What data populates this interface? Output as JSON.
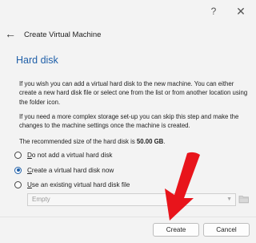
{
  "titlebar": {
    "help_label": "?",
    "close_label": "✕"
  },
  "header": {
    "back_label": "←",
    "title": "Create Virtual Machine"
  },
  "section_title": "Hard disk",
  "paragraphs": {
    "p1": "If you wish you can add a virtual hard disk to the new machine. You can either create a new hard disk file or select one from the list or from another location using the folder icon.",
    "p2": "If you need a more complex storage set-up you can skip this step and make the changes to the machine settings once the machine is created.",
    "p3_prefix": "The recommended size of the hard disk is ",
    "p3_size": "50.00 GB",
    "p3_suffix": "."
  },
  "options": {
    "no_disk": {
      "mnemonic": "D",
      "rest": "o not add a virtual hard disk",
      "selected": false
    },
    "create_now": {
      "mnemonic": "C",
      "rest": "reate a virtual hard disk now",
      "selected": true
    },
    "use_existing": {
      "mnemonic": "U",
      "rest": "se an existing virtual hard disk file",
      "selected": false
    }
  },
  "existing_disk_combo": {
    "value": "Empty",
    "arrow": "▼"
  },
  "buttons": {
    "create": "Create",
    "cancel": "Cancel"
  },
  "colors": {
    "accent": "#1f5fa8",
    "annotation_arrow": "#e8141b"
  },
  "icons": [
    "help-icon",
    "close-icon",
    "back-arrow-icon",
    "folder-icon",
    "chevron-down-icon"
  ]
}
